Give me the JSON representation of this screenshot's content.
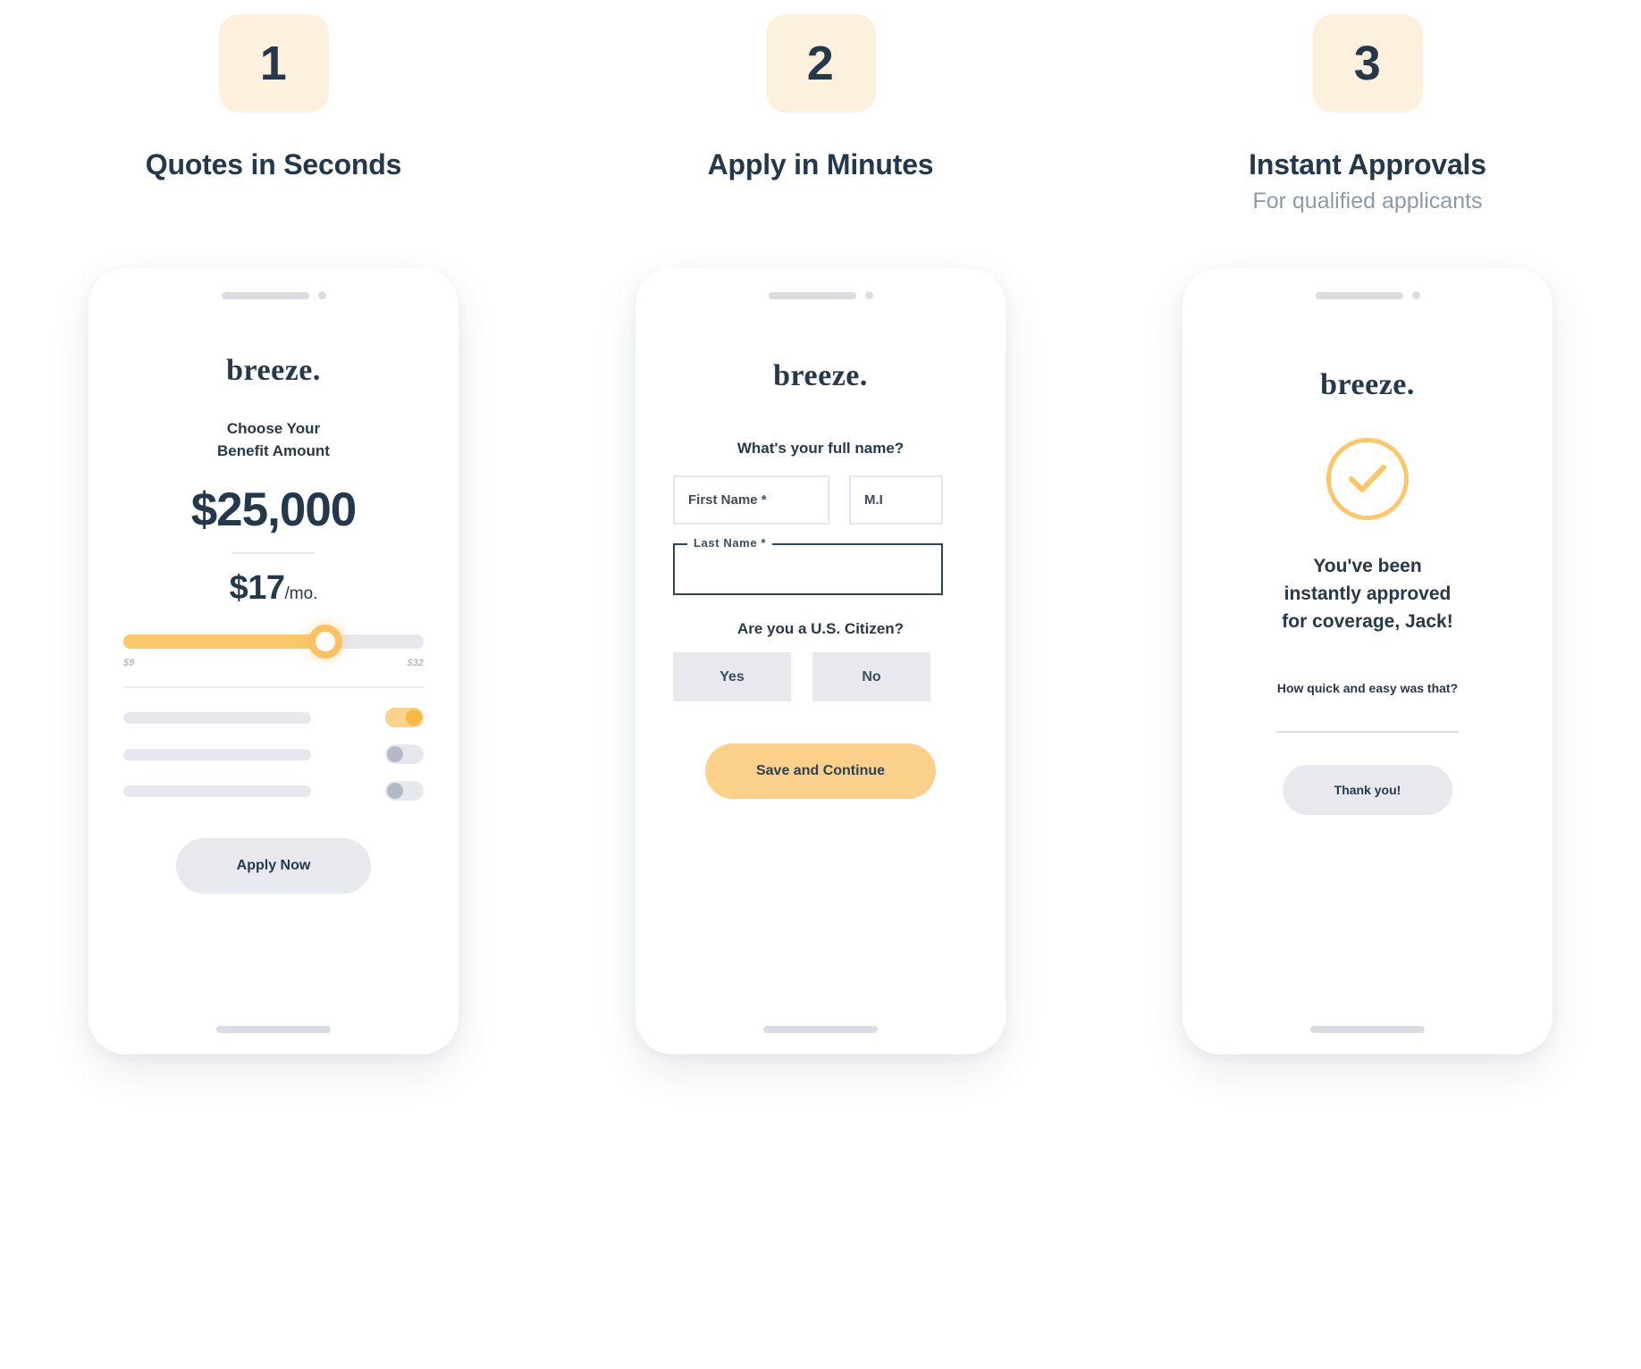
{
  "steps": [
    {
      "number": "1",
      "title": "Quotes in Seconds",
      "subtitle": ""
    },
    {
      "number": "2",
      "title": "Apply in Minutes",
      "subtitle": ""
    },
    {
      "number": "3",
      "title": "Instant Approvals",
      "subtitle": "For qualified applicants"
    }
  ],
  "colors": {
    "badge_bg": "#fdf1dd",
    "navy": "#24384b",
    "muted": "#8e9aa6",
    "accent_yellow": "#fac769",
    "button_grey": "#e7e9ef"
  },
  "phone1": {
    "brand": "breeze.",
    "heading_line1": "Choose Your",
    "heading_line2": "Benefit Amount",
    "benefit_amount": "$25,000",
    "price_value": "$17",
    "price_period": "/mo.",
    "slider": {
      "min_label": "$9",
      "max_label": "$32",
      "value_percent": 63
    },
    "options": [
      {
        "toggle_state": "on"
      },
      {
        "toggle_state": "off"
      },
      {
        "toggle_state": "off"
      }
    ],
    "apply_button": "Apply Now"
  },
  "phone2": {
    "brand": "breeze.",
    "question_name": "What's your full name?",
    "first_name_label": "First Name *",
    "middle_initial_label": "M.I",
    "last_name_label": "Last  Name *",
    "first_name_value": "",
    "middle_initial_value": "",
    "last_name_value": "",
    "question_citizen": "Are you a U.S. Citizen?",
    "choice_yes": "Yes",
    "choice_no": "No",
    "save_button": "Save and Continue"
  },
  "phone3": {
    "brand": "breeze.",
    "status_icon": "check-circle-icon",
    "message_line1": "You've been",
    "message_line2": "instantly approved",
    "message_line3": "for coverage, Jack!",
    "survey_question": "How quick and easy was that?",
    "thanks_button": "Thank you!"
  }
}
